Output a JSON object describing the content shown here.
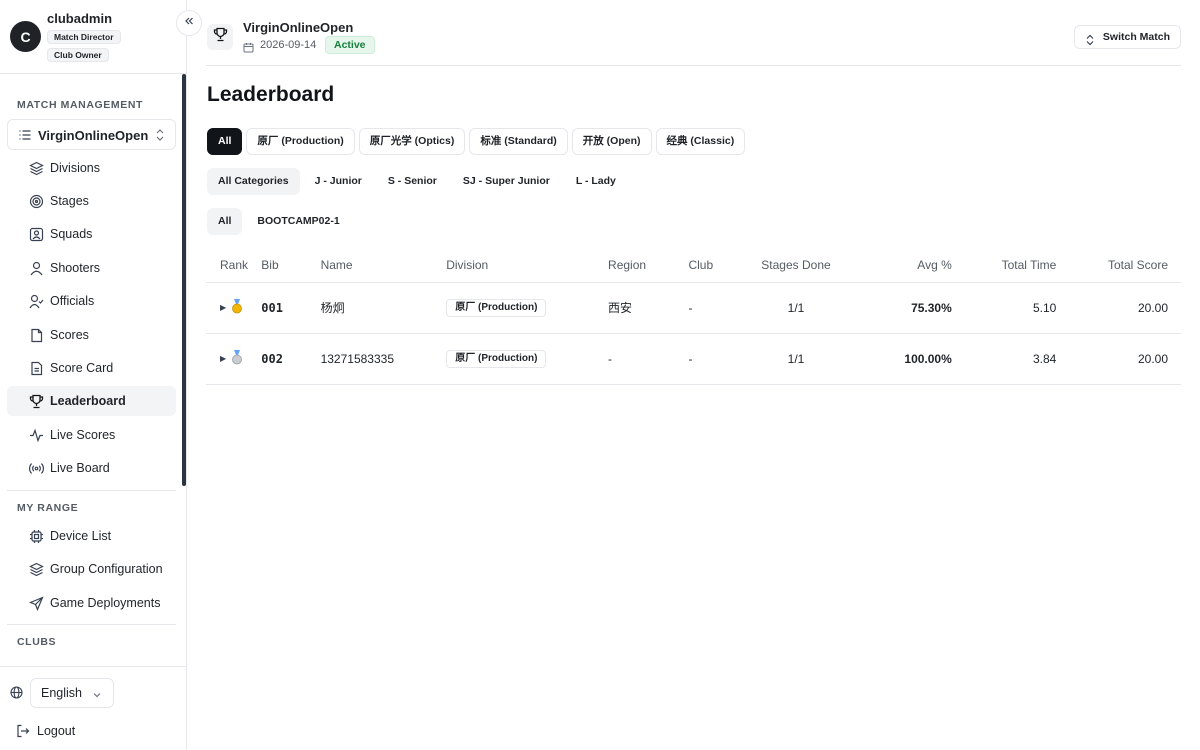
{
  "user": {
    "initial": "C",
    "name": "clubadmin",
    "roles": [
      "Match Director",
      "Club Owner"
    ]
  },
  "sidebar": {
    "match_management_title": "MATCH MANAGEMENT",
    "current_match": "VirginOnlineOpen",
    "items": [
      {
        "label": "Divisions",
        "icon": "layers-icon"
      },
      {
        "label": "Stages",
        "icon": "target-icon"
      },
      {
        "label": "Squads",
        "icon": "users-icon"
      },
      {
        "label": "Shooters",
        "icon": "user-icon"
      },
      {
        "label": "Officials",
        "icon": "user-check-icon"
      },
      {
        "label": "Scores",
        "icon": "file-icon"
      },
      {
        "label": "Score Card",
        "icon": "file-text-icon"
      },
      {
        "label": "Leaderboard",
        "icon": "trophy-icon",
        "active": true
      },
      {
        "label": "Live Scores",
        "icon": "activity-icon"
      },
      {
        "label": "Live Board",
        "icon": "broadcast-icon"
      }
    ],
    "my_range_title": "MY RANGE",
    "range_items": [
      {
        "label": "Device List",
        "icon": "cpu-icon"
      },
      {
        "label": "Group Configuration",
        "icon": "layers-icon"
      },
      {
        "label": "Game Deployments",
        "icon": "send-icon"
      }
    ],
    "clubs_title": "CLUBS",
    "language": "English",
    "logout": "Logout"
  },
  "header": {
    "match_name": "VirginOnlineOpen",
    "date": "2026-09-14",
    "status": "Active",
    "switch_label": "Switch Match"
  },
  "page": {
    "title": "Leaderboard"
  },
  "filters": {
    "divisions": [
      "All",
      "原厂 (Production)",
      "原厂光学 (Optics)",
      "标准 (Standard)",
      "开放 (Open)",
      "经典 (Classic)"
    ],
    "categories": [
      "All Categories",
      "J - Junior",
      "S - Senior",
      "SJ - Super Junior",
      "L - Lady"
    ],
    "squads": [
      "All",
      "BOOTCAMP02-1"
    ]
  },
  "table": {
    "headers": [
      "Rank",
      "Bib",
      "Name",
      "Division",
      "Region",
      "Club",
      "Stages Done",
      "Avg %",
      "Total Time",
      "Total Score"
    ],
    "rows": [
      {
        "medal": "gold",
        "bib": "001",
        "name": "杨炯",
        "division": "原厂 (Production)",
        "region": "西安",
        "club": "-",
        "stages": "1/1",
        "avg": "75.30%",
        "time": "5.10",
        "score": "20.00"
      },
      {
        "medal": "silver",
        "bib": "002",
        "name": "13271583335",
        "division": "原厂 (Production)",
        "region": "-",
        "club": "-",
        "stages": "1/1",
        "avg": "100.00%",
        "time": "3.84",
        "score": "20.00"
      }
    ]
  },
  "colors": {
    "accent": "#111418",
    "status_green": "#16803c",
    "gold": "#f2b705",
    "silver": "#b8bcc4"
  }
}
